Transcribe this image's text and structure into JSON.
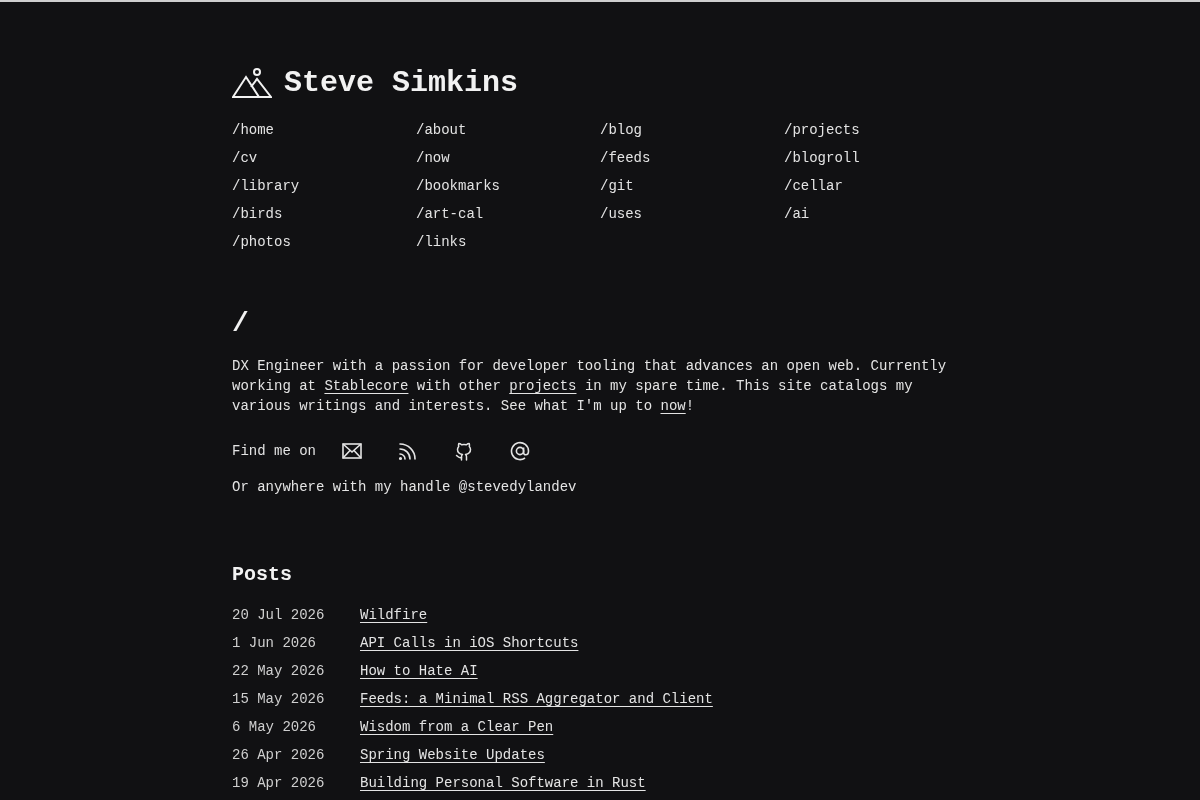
{
  "site": {
    "title": "Steve Simkins"
  },
  "nav": [
    {
      "label": "/home"
    },
    {
      "label": "/about"
    },
    {
      "label": "/blog"
    },
    {
      "label": "/projects"
    },
    {
      "label": "/cv"
    },
    {
      "label": "/now"
    },
    {
      "label": "/feeds"
    },
    {
      "label": "/blogroll"
    },
    {
      "label": "/library"
    },
    {
      "label": "/bookmarks"
    },
    {
      "label": "/git"
    },
    {
      "label": "/cellar"
    },
    {
      "label": "/birds"
    },
    {
      "label": "/art-cal"
    },
    {
      "label": "/uses"
    },
    {
      "label": "/ai"
    },
    {
      "label": "/photos"
    },
    {
      "label": "/links"
    }
  ],
  "intro": {
    "heading": "/",
    "paragraph": [
      {
        "kind": "text",
        "text": "DX Engineer with a passion for developer tooling that advances an open web. Currently working at "
      },
      {
        "kind": "link",
        "text": "Stablecore"
      },
      {
        "kind": "text",
        "text": " with other "
      },
      {
        "kind": "link",
        "text": "projects"
      },
      {
        "kind": "text",
        "text": " in my spare time. This site catalogs my various writings and interests. See what I'm up to "
      },
      {
        "kind": "link",
        "text": "now"
      },
      {
        "kind": "text",
        "text": "!"
      }
    ]
  },
  "social": {
    "label": "Find me on",
    "links": [
      {
        "kind": "email"
      },
      {
        "kind": "rss"
      },
      {
        "kind": "github"
      },
      {
        "kind": "at"
      }
    ],
    "handle_text": "Or anywhere with my handle @stevedylandev"
  },
  "posts": {
    "heading": "Posts",
    "items": [
      {
        "date": "20 Jul 2026",
        "title": "Wildfire"
      },
      {
        "date": "1 Jun 2026",
        "title": "API Calls in iOS Shortcuts"
      },
      {
        "date": "22 May 2026",
        "title": "How to Hate AI"
      },
      {
        "date": "15 May 2026",
        "title": "Feeds: a Minimal RSS Aggregator and Client"
      },
      {
        "date": "6 May 2026",
        "title": "Wisdom from a Clear Pen"
      },
      {
        "date": "26 Apr 2026",
        "title": "Spring Website Updates"
      },
      {
        "date": "19 Apr 2026",
        "title": "Building Personal Software in Rust"
      }
    ]
  }
}
